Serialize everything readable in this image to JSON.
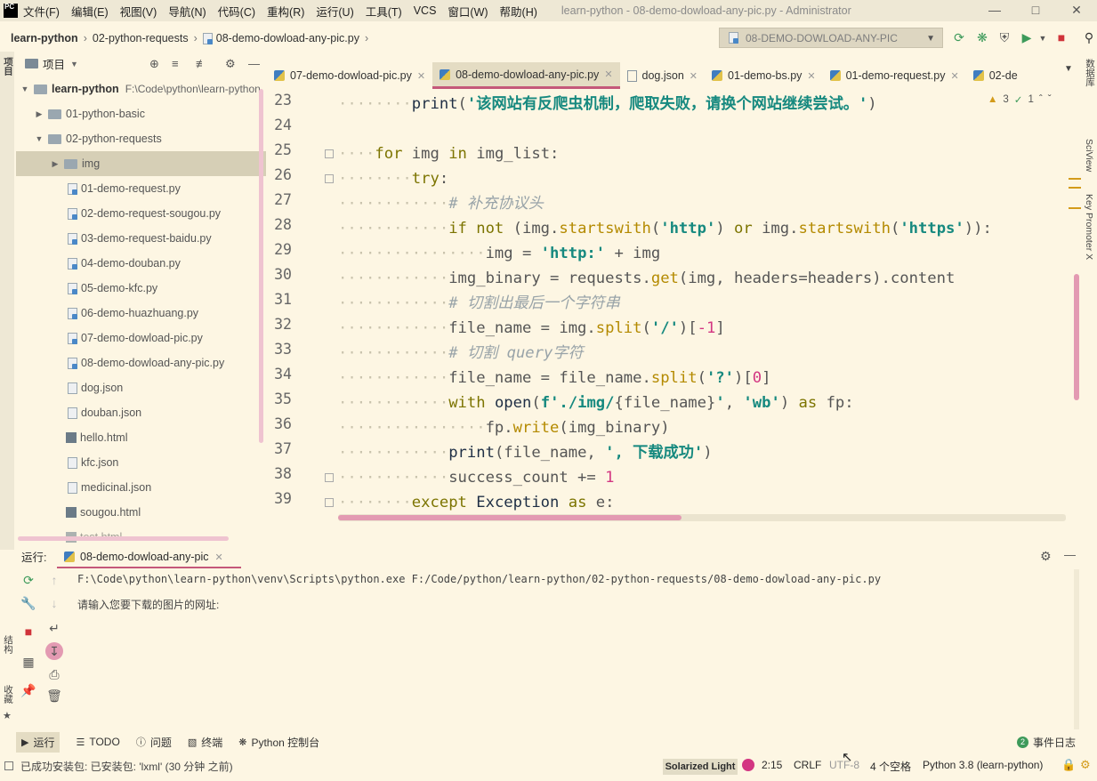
{
  "menubar": {
    "logo": "PC",
    "items": [
      "文件(F)",
      "编辑(E)",
      "视图(V)",
      "导航(N)",
      "代码(C)",
      "重构(R)",
      "运行(U)",
      "工具(T)",
      "VCS",
      "窗口(W)",
      "帮助(H)"
    ],
    "window_title": "learn-python - 08-demo-dowload-any-pic.py - Administrator"
  },
  "navbar": {
    "crumbs": [
      "learn-python",
      "02-python-requests",
      "08-demo-dowload-any-pic.py"
    ],
    "run_config": "08-DEMO-DOWLOAD-ANY-PIC"
  },
  "project": {
    "title": "项目",
    "root_name": "learn-python",
    "root_path": "F:\\Code\\python\\learn-python",
    "items": [
      {
        "label": "01-python-basic",
        "type": "folder"
      },
      {
        "label": "02-python-requests",
        "type": "folder"
      },
      {
        "label": "img",
        "type": "folder"
      },
      {
        "label": "01-demo-request.py",
        "type": "py"
      },
      {
        "label": "02-demo-request-sougou.py",
        "type": "py"
      },
      {
        "label": "03-demo-request-baidu.py",
        "type": "py"
      },
      {
        "label": "04-demo-douban.py",
        "type": "py"
      },
      {
        "label": "05-demo-kfc.py",
        "type": "py"
      },
      {
        "label": "06-demo-huazhuang.py",
        "type": "py"
      },
      {
        "label": "07-demo-dowload-pic.py",
        "type": "py"
      },
      {
        "label": "08-demo-dowload-any-pic.py",
        "type": "py"
      },
      {
        "label": "dog.json",
        "type": "json"
      },
      {
        "label": "douban.json",
        "type": "json"
      },
      {
        "label": "hello.html",
        "type": "html"
      },
      {
        "label": "kfc.json",
        "type": "json"
      },
      {
        "label": "medicinal.json",
        "type": "json"
      },
      {
        "label": "sougou.html",
        "type": "html"
      },
      {
        "label": "test.html",
        "type": "html"
      }
    ]
  },
  "tabs": [
    {
      "label": "07-demo-dowload-pic.py",
      "icon": "python-icon"
    },
    {
      "label": "08-demo-dowload-any-pic.py",
      "icon": "python-icon",
      "active": true
    },
    {
      "label": "dog.json",
      "icon": "json-icon"
    },
    {
      "label": "01-demo-bs.py",
      "icon": "python-icon"
    },
    {
      "label": "01-demo-request.py",
      "icon": "python-icon"
    },
    {
      "label": "02-de",
      "icon": "python-icon"
    }
  ],
  "inspection": {
    "warnings": "3",
    "typos": "1"
  },
  "editor": {
    "line_numbers": [
      "23",
      "24",
      "25",
      "26",
      "27",
      "28",
      "29",
      "30",
      "31",
      "32",
      "33",
      "34",
      "35",
      "36",
      "37",
      "38",
      "39"
    ],
    "lines": [
      "print('该网站有反爬虫机制，爬取失败，请换个网站继续尝试。')",
      "",
      "for img in img_list:",
      "try:",
      "# 补充协议头",
      "if not (img.startswith('http') or img.startswith('https')):",
      "img = 'http:' + img",
      "img_binary = requests.get(img, headers=headers).content",
      "# 切割出最后一个字符串",
      "file_name = img.split('/')[-1]",
      "# 切割 query字符",
      "file_name = file_name.split('?')[0]",
      "with open(f'./img/{file_name}', 'wb') as fp:",
      "fp.write(img_binary)",
      "print(file_name, ', 下载成功')",
      "success_count += 1",
      "except Exception as e:"
    ]
  },
  "right_tools": [
    "数据库",
    "SciView",
    "Key Promoter X"
  ],
  "left_tools": [
    "项目",
    "结构",
    "收藏"
  ],
  "run": {
    "label": "运行:",
    "tab": "08-demo-dowload-any-pic",
    "command": "F:\\Code\\python\\learn-python\\venv\\Scripts\\python.exe F:/Code/python/learn-python/02-python-requests/08-demo-dowload-any-pic.py",
    "prompt": "请输入您要下载的图片的网址:"
  },
  "bottom_tools": [
    "运行",
    "TODO",
    "问题",
    "终端",
    "Python 控制台"
  ],
  "event_log": {
    "count": "2",
    "label": "事件日志"
  },
  "status": {
    "message": "已成功安装包: 已安装包: 'lxml' (30 分钟 之前)",
    "theme": "Solarized Light",
    "position": "2:15",
    "line_sep": "CRLF",
    "encoding": "UTF-8",
    "indent": "4 个空格",
    "interpreter": "Python 3.8 (learn-python)"
  },
  "colors": {
    "accent": "#c4587a",
    "background": "#fdf6e3",
    "selection": "#d6cfb6"
  }
}
